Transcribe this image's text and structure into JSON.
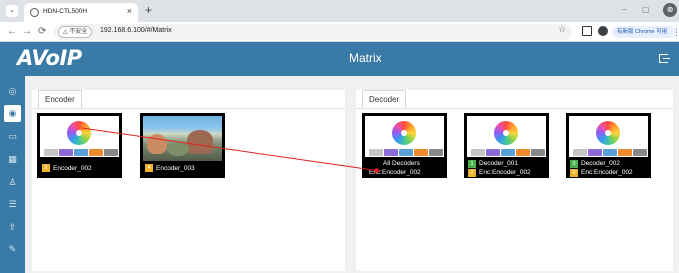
{
  "browser": {
    "tab_menu_glyph": "⌄",
    "tab_title": "HDN-CTL500H",
    "tab_close_glyph": "×",
    "new_tab_glyph": "+",
    "minimize_glyph": "–",
    "restore_glyph": "▢",
    "close_glyph": "⊗",
    "back_glyph": "←",
    "forward_glyph": "→",
    "reload_glyph": "⟳",
    "security_chip": "△ 不安全",
    "url": "192.168.6.100/#/Matrix",
    "star_glyph": "☆",
    "profile_pill": "有新版 Chrome 可用",
    "menu_glyph": "⋮"
  },
  "app": {
    "logo": "AVoIP",
    "title": "Matrix",
    "colors": {
      "header": "#3a7aa6",
      "route_line": "#e02020",
      "badge_yellow": "#f0b429",
      "badge_green": "#4caf50"
    }
  },
  "sidenav": {
    "items": [
      {
        "icon": "layers-icon",
        "glyph": "◎"
      },
      {
        "icon": "matrix-icon",
        "glyph": "◉"
      },
      {
        "icon": "devices-icon",
        "glyph": "▭"
      },
      {
        "icon": "grid-icon",
        "glyph": "▦"
      },
      {
        "icon": "user-icon",
        "glyph": "♙"
      },
      {
        "icon": "settings-icon",
        "glyph": "☰"
      },
      {
        "icon": "upload-icon",
        "glyph": "⇪"
      },
      {
        "icon": "wrench-icon",
        "glyph": "✎"
      }
    ]
  },
  "encoder_panel": {
    "tab": "Encoder",
    "cards": [
      {
        "badge": "2",
        "label": "Encoder_002",
        "preview": "photos"
      },
      {
        "badge": "4",
        "label": "Encoder_003",
        "preview": "video"
      }
    ]
  },
  "decoder_panel": {
    "tab": "Decoder",
    "cards": [
      {
        "line1_badge": "",
        "line1": "All Decoders",
        "line2_badge": "",
        "line2": "Enc:Encoder_002"
      },
      {
        "line1_badge": "1",
        "line1": "Decoder_001",
        "line2_badge": "2",
        "line2": "Enc:Encoder_002"
      },
      {
        "line1_badge": "3",
        "line1": "Decoder_002",
        "line2_badge": "2",
        "line2": "Enc:Encoder_002"
      }
    ]
  }
}
